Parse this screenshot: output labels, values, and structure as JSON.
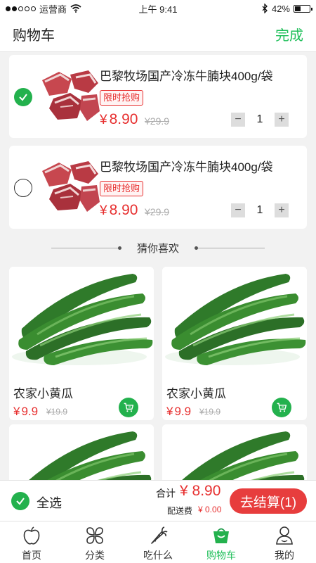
{
  "status_bar": {
    "carrier": "运营商",
    "time": "上午 9:41",
    "battery": "42%",
    "battery_level": 0.42
  },
  "header": {
    "title": "购物车",
    "done_label": "完成"
  },
  "cart_items": [
    {
      "name": "巴黎牧场国产冷冻牛腩块400g/袋",
      "tag": "限时抢购",
      "currency": "¥",
      "price": "8.90",
      "old_price": "¥29.9",
      "quantity": "1",
      "checked": true,
      "minus": "−",
      "plus": "+"
    },
    {
      "name": "巴黎牧场国产冷冻牛腩块400g/袋",
      "tag": "限时抢购",
      "currency": "¥",
      "price": "8.90",
      "old_price": "¥29.9",
      "quantity": "1",
      "checked": false,
      "minus": "−",
      "plus": "+"
    }
  ],
  "recommend": {
    "title": "猜你喜欢",
    "items": [
      {
        "name": "农家小黄瓜",
        "currency": "¥",
        "price": "9.9",
        "old_price": "¥19.9"
      },
      {
        "name": "农家小黄瓜",
        "currency": "¥",
        "price": "9.9",
        "old_price": "¥19.9"
      }
    ]
  },
  "bottom_bar": {
    "select_all_label": "全选",
    "total_label": "合计",
    "total": "¥ 8.90",
    "shipping_label": "配送费",
    "shipping": "¥ 0.00",
    "checkout_label": "去结算(1)"
  },
  "tabs": [
    {
      "label": "首页",
      "icon": "apple-icon",
      "active": false
    },
    {
      "label": "分类",
      "icon": "category-icon",
      "active": false
    },
    {
      "label": "吃什么",
      "icon": "carrot-icon",
      "active": false
    },
    {
      "label": "购物车",
      "icon": "basket-icon",
      "active": true
    },
    {
      "label": "我的",
      "icon": "user-icon",
      "active": false
    }
  ],
  "colors": {
    "accent_green": "#23b14d",
    "price_red": "#e73030",
    "background": "#f2f2f2"
  }
}
